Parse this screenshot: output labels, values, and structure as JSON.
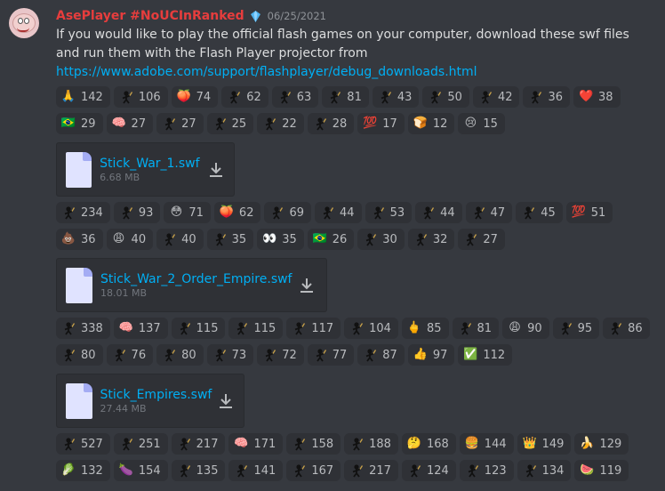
{
  "message": {
    "username": "AsePlayer #NoUCInRanked",
    "timestamp": "06/25/2021",
    "text": "If you would like to play the official flash games on your computer, download these swf files and run them with the Flash Player projector from",
    "link": "https://www.adobe.com/support/flashplayer/debug_downloads.html"
  },
  "colors": {
    "username": "#e73d3d",
    "link": "#00aff4",
    "background": "#36393f",
    "pill": "#2f3136"
  },
  "reactions_1": [
    {
      "icon": "🙏",
      "count": "142"
    },
    {
      "icon": "stick-icon",
      "count": "106"
    },
    {
      "icon": "🍑",
      "count": "74"
    },
    {
      "icon": "stick-icon",
      "count": "62"
    },
    {
      "icon": "stick-icon",
      "count": "63"
    },
    {
      "icon": "stick-icon",
      "count": "81"
    },
    {
      "icon": "stick-icon",
      "count": "43"
    },
    {
      "icon": "stick-icon",
      "count": "50"
    },
    {
      "icon": "stick-icon",
      "count": "42"
    },
    {
      "icon": "stick-icon",
      "count": "36"
    },
    {
      "icon": "❤️",
      "count": "38"
    },
    {
      "icon": "🇧🇷",
      "count": "29"
    },
    {
      "icon": "🧠",
      "count": "27"
    },
    {
      "icon": "stick-icon",
      "count": "27"
    },
    {
      "icon": "stick-icon",
      "count": "25"
    },
    {
      "icon": "stick-icon",
      "count": "22"
    },
    {
      "icon": "stick-icon",
      "count": "28"
    },
    {
      "icon": "💯",
      "count": "17"
    },
    {
      "icon": "🍞",
      "count": "12"
    },
    {
      "icon": "😢",
      "count": "15"
    }
  ],
  "attachment_1": {
    "name": "Stick_War_1.swf",
    "size": "6.68 MB"
  },
  "reactions_2": [
    {
      "icon": "stick-icon",
      "count": "234"
    },
    {
      "icon": "stick-icon",
      "count": "93"
    },
    {
      "icon": "😳",
      "count": "71"
    },
    {
      "icon": "🍑",
      "count": "62"
    },
    {
      "icon": "stick-icon",
      "count": "69"
    },
    {
      "icon": "stick-icon",
      "count": "44"
    },
    {
      "icon": "stick-icon",
      "count": "53"
    },
    {
      "icon": "stick-icon",
      "count": "44"
    },
    {
      "icon": "stick-icon",
      "count": "47"
    },
    {
      "icon": "stick-icon",
      "count": "45"
    },
    {
      "icon": "💯",
      "count": "51"
    },
    {
      "icon": "💩",
      "count": "36"
    },
    {
      "icon": "😩",
      "count": "40"
    },
    {
      "icon": "stick-icon",
      "count": "40"
    },
    {
      "icon": "stick-icon",
      "count": "35"
    },
    {
      "icon": "👀",
      "count": "35"
    },
    {
      "icon": "🇧🇷",
      "count": "26"
    },
    {
      "icon": "stick-icon",
      "count": "30"
    },
    {
      "icon": "stick-icon",
      "count": "32"
    },
    {
      "icon": "stick-icon",
      "count": "27"
    }
  ],
  "attachment_2": {
    "name": "Stick_War_2_Order_Empire.swf",
    "size": "18.01 MB"
  },
  "reactions_3": [
    {
      "icon": "stick-icon",
      "count": "338"
    },
    {
      "icon": "🧠",
      "count": "137"
    },
    {
      "icon": "stick-icon",
      "count": "115"
    },
    {
      "icon": "stick-icon",
      "count": "115"
    },
    {
      "icon": "stick-icon",
      "count": "117"
    },
    {
      "icon": "stick-icon",
      "count": "104"
    },
    {
      "icon": "🖕",
      "count": "85"
    },
    {
      "icon": "stick-icon",
      "count": "81"
    },
    {
      "icon": "😩",
      "count": "90"
    },
    {
      "icon": "stick-icon",
      "count": "95"
    },
    {
      "icon": "stick-icon",
      "count": "86"
    },
    {
      "icon": "stick-icon",
      "count": "80"
    },
    {
      "icon": "stick-icon",
      "count": "76"
    },
    {
      "icon": "stick-icon",
      "count": "80"
    },
    {
      "icon": "stick-icon",
      "count": "73"
    },
    {
      "icon": "stick-icon",
      "count": "72"
    },
    {
      "icon": "stick-icon",
      "count": "77"
    },
    {
      "icon": "stick-icon",
      "count": "87"
    },
    {
      "icon": "👍",
      "count": "97"
    },
    {
      "icon": "✅",
      "count": "112"
    }
  ],
  "attachment_3": {
    "name": "Stick_Empires.swf",
    "size": "27.44 MB"
  },
  "reactions_4": [
    {
      "icon": "stick-icon",
      "count": "527"
    },
    {
      "icon": "stick-icon",
      "count": "251"
    },
    {
      "icon": "stick-icon",
      "count": "217"
    },
    {
      "icon": "🧠",
      "count": "171"
    },
    {
      "icon": "stick-icon",
      "count": "158"
    },
    {
      "icon": "stick-icon",
      "count": "188"
    },
    {
      "icon": "🤔",
      "count": "168"
    },
    {
      "icon": "🍔",
      "count": "144"
    },
    {
      "icon": "👑",
      "count": "149"
    },
    {
      "icon": "🍌",
      "count": "129"
    },
    {
      "icon": "🥬",
      "count": "132"
    },
    {
      "icon": "🍆",
      "count": "154"
    },
    {
      "icon": "stick-icon",
      "count": "135"
    },
    {
      "icon": "stick-icon",
      "count": "141"
    },
    {
      "icon": "stick-icon",
      "count": "167"
    },
    {
      "icon": "stick-icon",
      "count": "217"
    },
    {
      "icon": "stick-icon",
      "count": "124"
    },
    {
      "icon": "stick-icon",
      "count": "123"
    },
    {
      "icon": "stick-icon",
      "count": "134"
    },
    {
      "icon": "🍉",
      "count": "119"
    }
  ]
}
